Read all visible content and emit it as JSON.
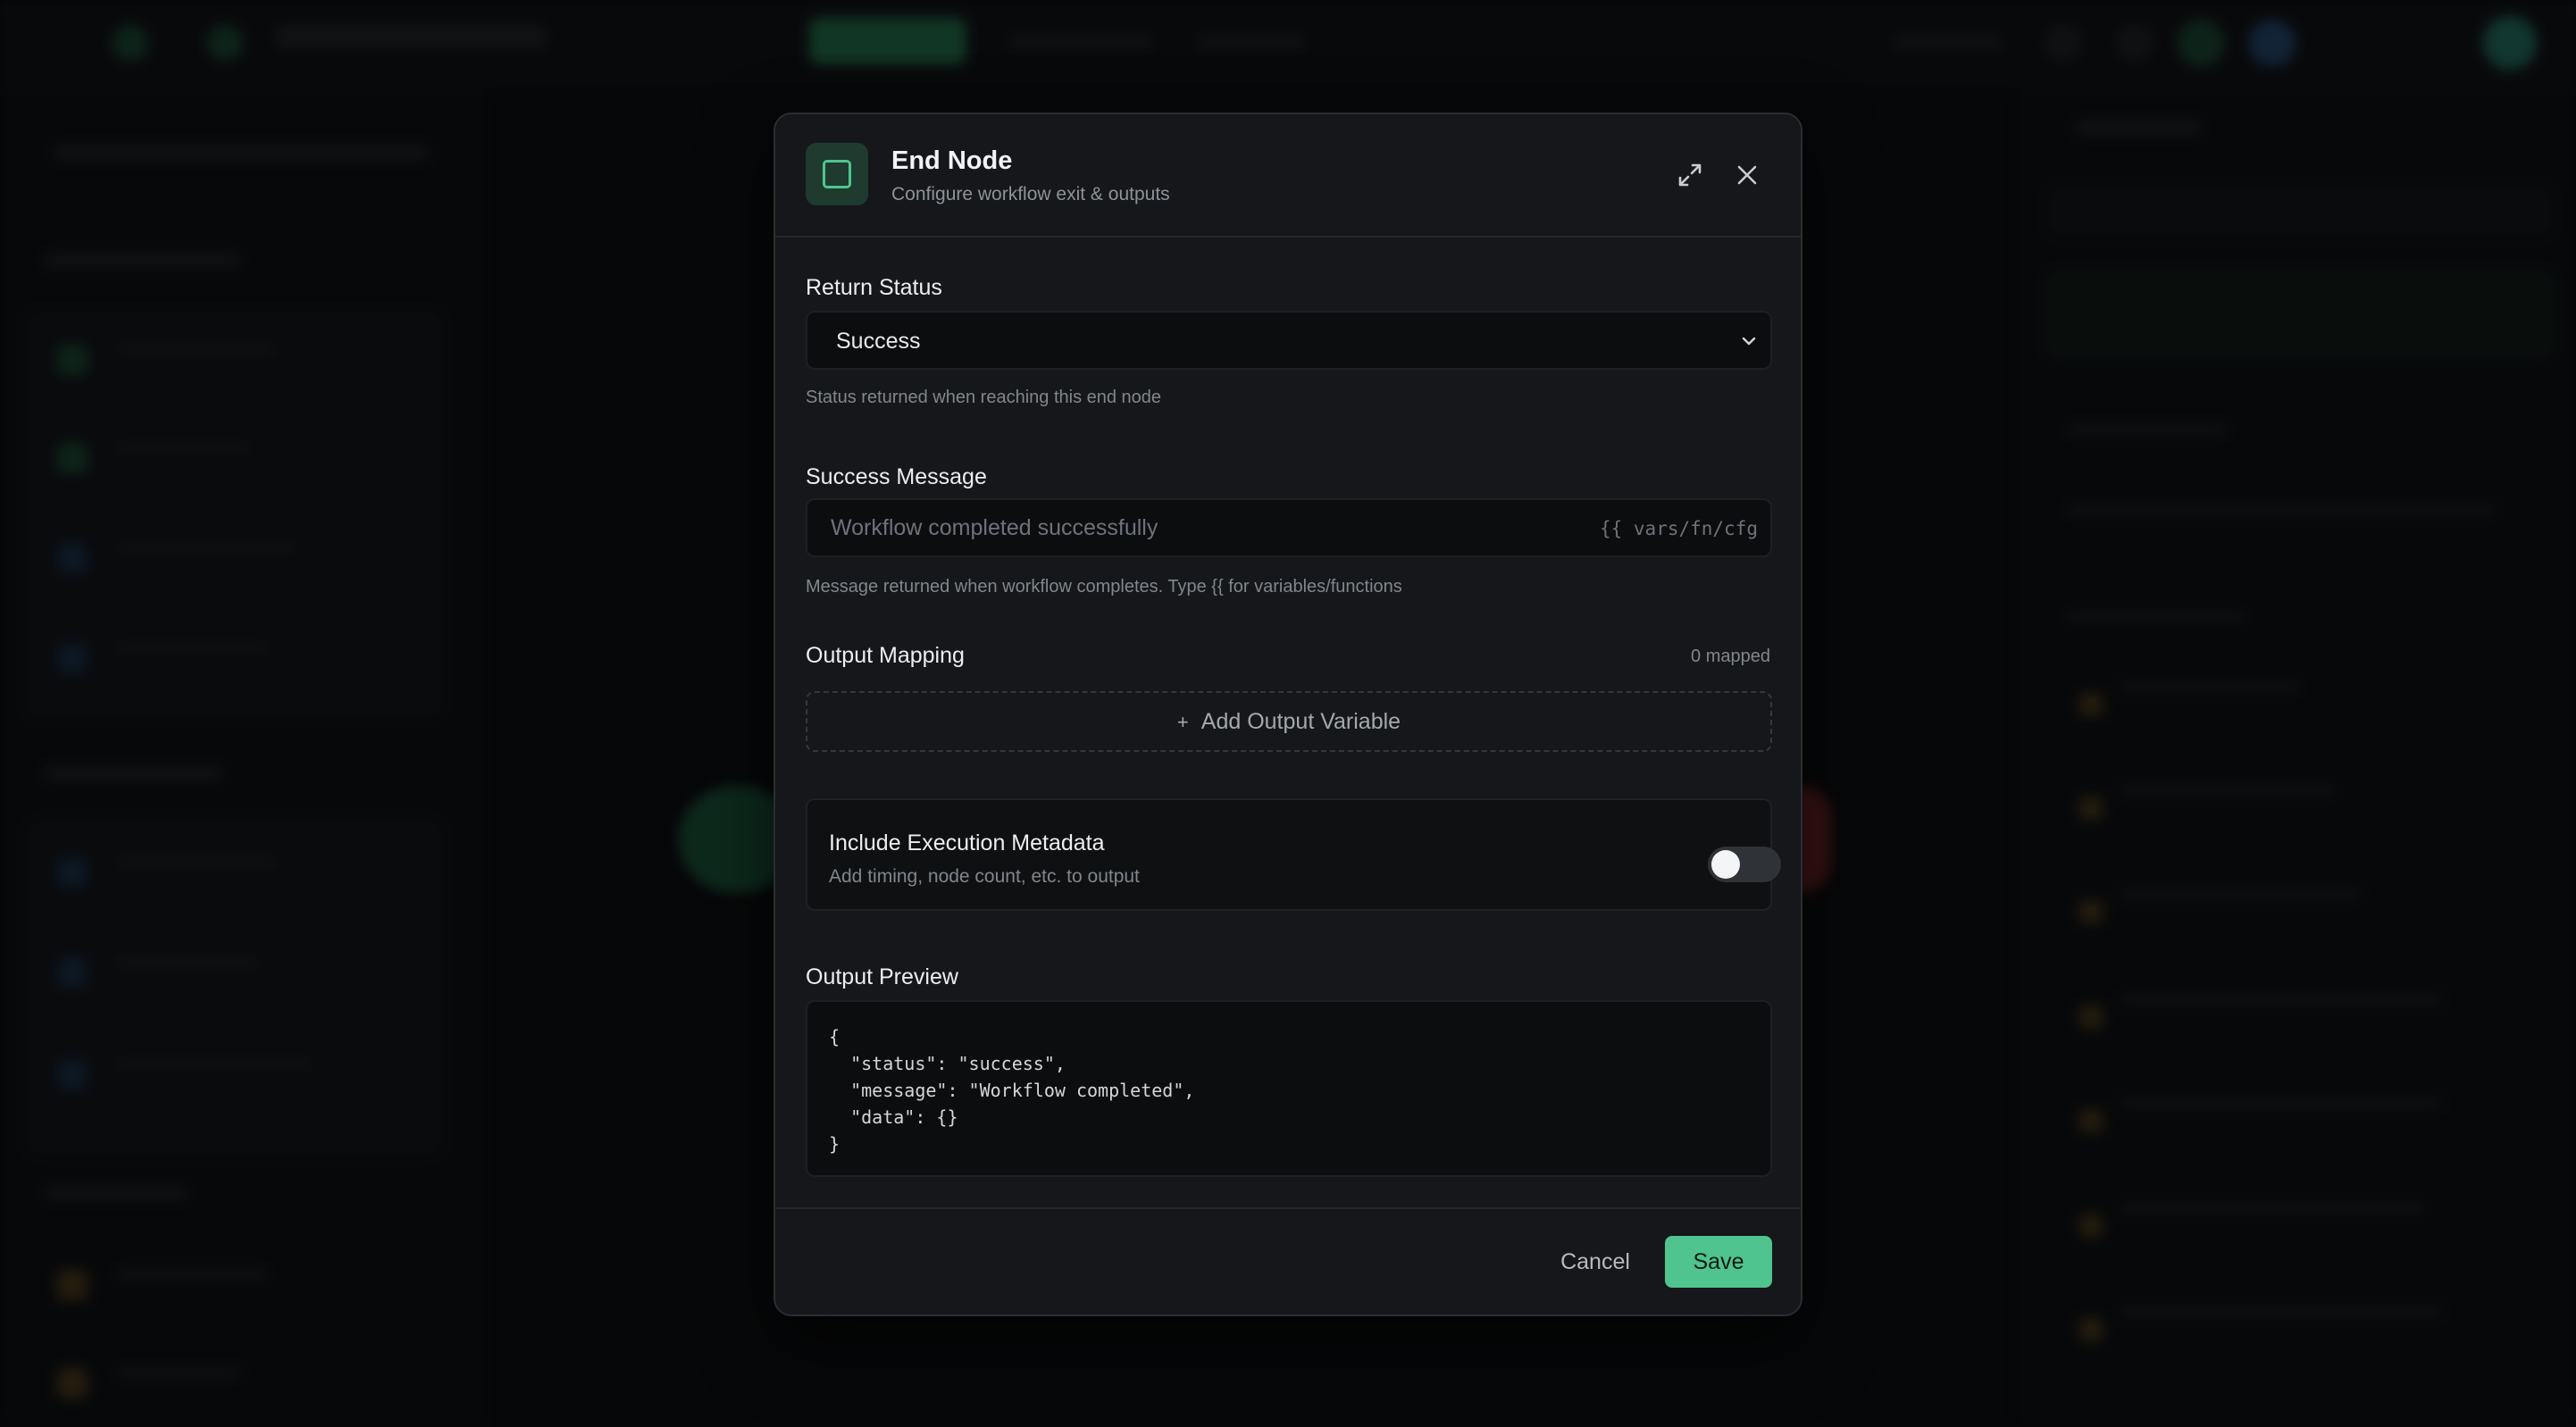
{
  "modal": {
    "title": "End Node",
    "subtitle": "Configure workflow exit & outputs"
  },
  "return_status": {
    "label": "Return Status",
    "selected": "Success",
    "helper": "Status returned when reaching this end node"
  },
  "success_message": {
    "label": "Success Message",
    "value": "",
    "placeholder": "Workflow completed successfully",
    "vars_hint": "{{ vars/fn/cfg",
    "helper": "Message returned when workflow completes. Type {{ for variables/functions"
  },
  "output_mapping": {
    "label": "Output Mapping",
    "count": "0 mapped",
    "add_label": "Add Output Variable"
  },
  "metadata": {
    "title": "Include Execution Metadata",
    "subtitle": "Add timing, node count, etc. to output",
    "enabled": false
  },
  "output_preview": {
    "label": "Output Preview",
    "lines": [
      "{",
      "  \"status\": \"success\",",
      "  \"message\": \"Workflow completed\",",
      "  \"data\": {}",
      "}"
    ]
  },
  "footer": {
    "cancel_label": "Cancel",
    "save_label": "Save"
  },
  "colors": {
    "accent": "#4fc48e",
    "background": "#0a0b0d",
    "modal": "#15171a"
  }
}
